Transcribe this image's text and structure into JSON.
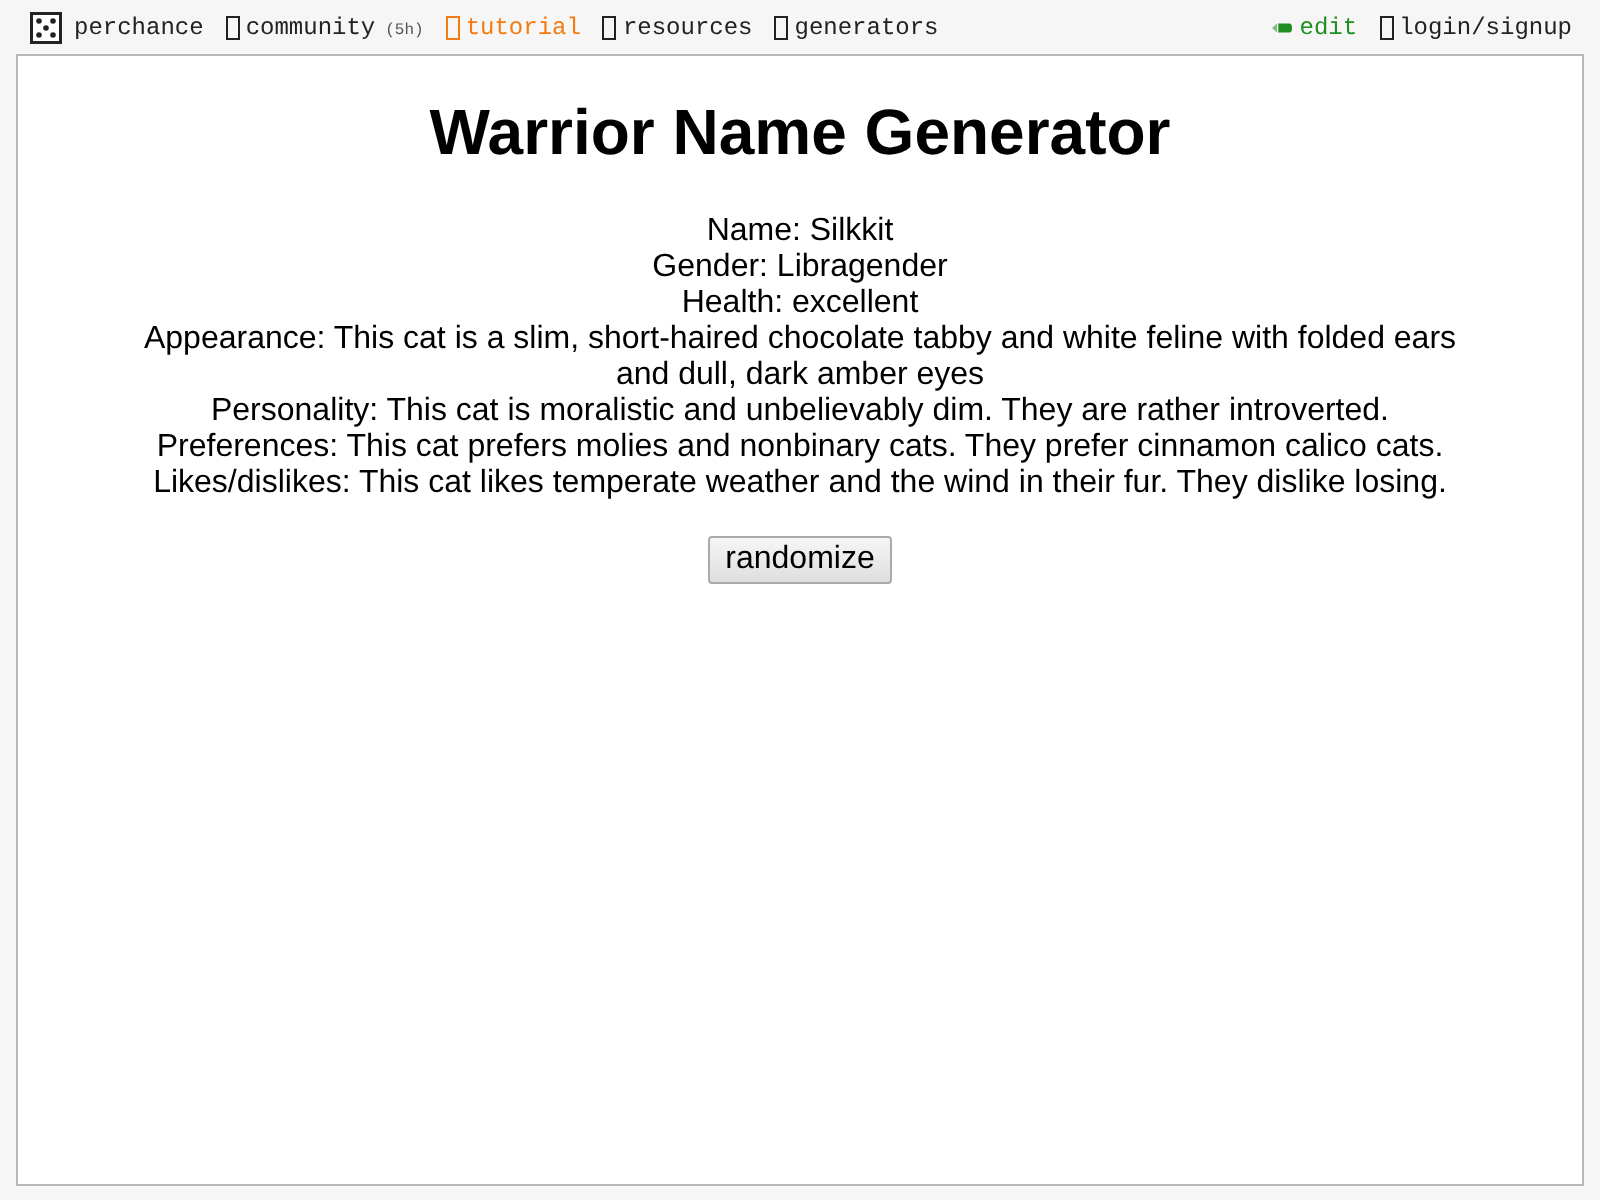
{
  "nav": {
    "brand": {
      "label": "perchance"
    },
    "links": [
      {
        "label": "community",
        "badge": "(5h)",
        "color": "#222222"
      },
      {
        "label": "tutorial",
        "color": "#f47b0f"
      },
      {
        "label": "resources",
        "color": "#222222"
      },
      {
        "label": "generators",
        "color": "#222222"
      }
    ],
    "right": [
      {
        "kind": "edit",
        "label": "edit",
        "color": "#1f8f1f"
      },
      {
        "kind": "link",
        "label": "login/signup",
        "color": "#222222"
      }
    ]
  },
  "generator": {
    "title": "Warrior Name Generator",
    "lines": [
      "Name: Silkkit",
      "Gender: Libragender",
      "Health: excellent",
      "Appearance: This cat is a slim, short-haired chocolate tabby and white feline with folded ears and dull, dark amber eyes",
      "Personality: This cat is moralistic and unbelievably dim. They are rather introverted.",
      "Preferences: This cat prefers molies and nonbinary cats. They prefer cinnamon calico cats.",
      "Likes/dislikes: This cat likes temperate weather and the wind in their fur. They dislike losing."
    ],
    "button": {
      "label": "randomize"
    }
  }
}
